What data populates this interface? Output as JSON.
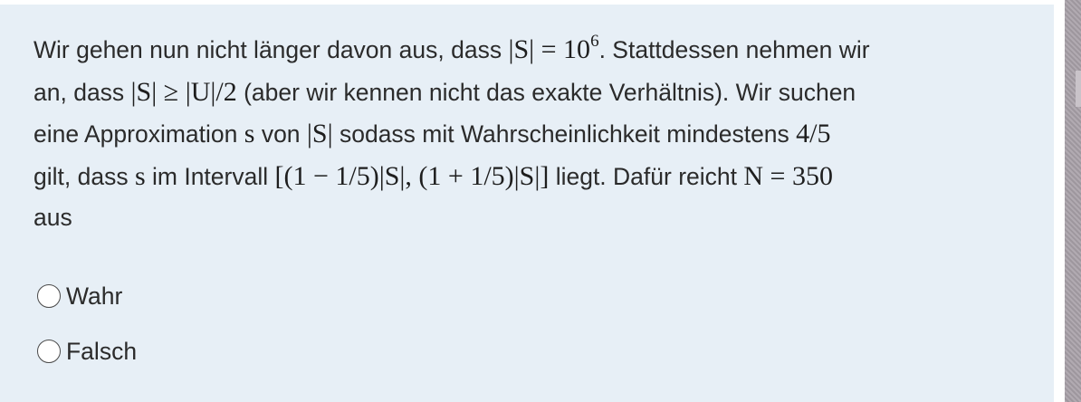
{
  "question": {
    "l1_a": "Wir gehen nun nicht länger davon aus, dass ",
    "l1_m1": "|S| = 10",
    "l1_sup": "6",
    "l1_b": ". Stattdessen nehmen wir",
    "l2_a": "an, dass ",
    "l2_m1": "|S| ≥ |U|/2",
    "l2_b": " (aber wir kennen nicht das exakte Verhältnis). Wir suchen",
    "l3_a": "eine Approximation ",
    "l3_m1": "s",
    "l3_b": " von ",
    "l3_m2": "|S|",
    "l3_c": " sodass mit Wahrscheinlichkeit mindestens ",
    "l3_m3": "4/5",
    "l4_a": "gilt, dass ",
    "l4_m1": "s",
    "l4_b": " im Intervall ",
    "l4_m2": "[(1 − 1/5)|S|, (1 + 1/5)|S|]",
    "l4_c": " liegt. Dafür reicht ",
    "l4_m3": "N = 350",
    "l5_a": "aus"
  },
  "options": [
    {
      "label": "Wahr"
    },
    {
      "label": "Falsch"
    }
  ]
}
